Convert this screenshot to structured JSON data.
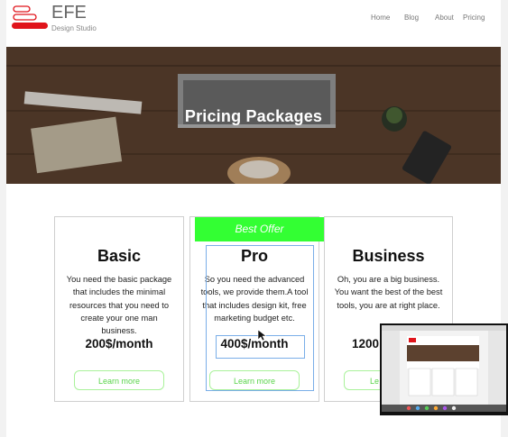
{
  "brand": {
    "name": "EFE",
    "subtitle": "Design Studio"
  },
  "nav": [
    "Home",
    "Blog",
    "About",
    "Pricing"
  ],
  "hero": {
    "title": "Pricing Packages"
  },
  "offer_badge": "Best Offer",
  "plans": [
    {
      "title": "Basic",
      "description": "You need the basic package that includes the minimal resources that you need to create your one man business.",
      "price": "200$/month",
      "button": "Learn more"
    },
    {
      "title": "Pro",
      "description": "So you need the advanced tools, we provide them.A tool that includes design kit, free marketing budget etc.",
      "price": "400$/month",
      "button": "Learn more"
    },
    {
      "title": "Business",
      "description": "Oh, you are a big business. You want the best of the best tools, you are at right place.",
      "price": "1200",
      "button": "Le"
    }
  ],
  "colors": {
    "accent_green": "#33ff33",
    "logo_red": "#e0141b",
    "selection_blue": "#7aaee8"
  },
  "icons": {
    "logo": "logo-mark-icon",
    "cursor": "cursor-icon"
  }
}
